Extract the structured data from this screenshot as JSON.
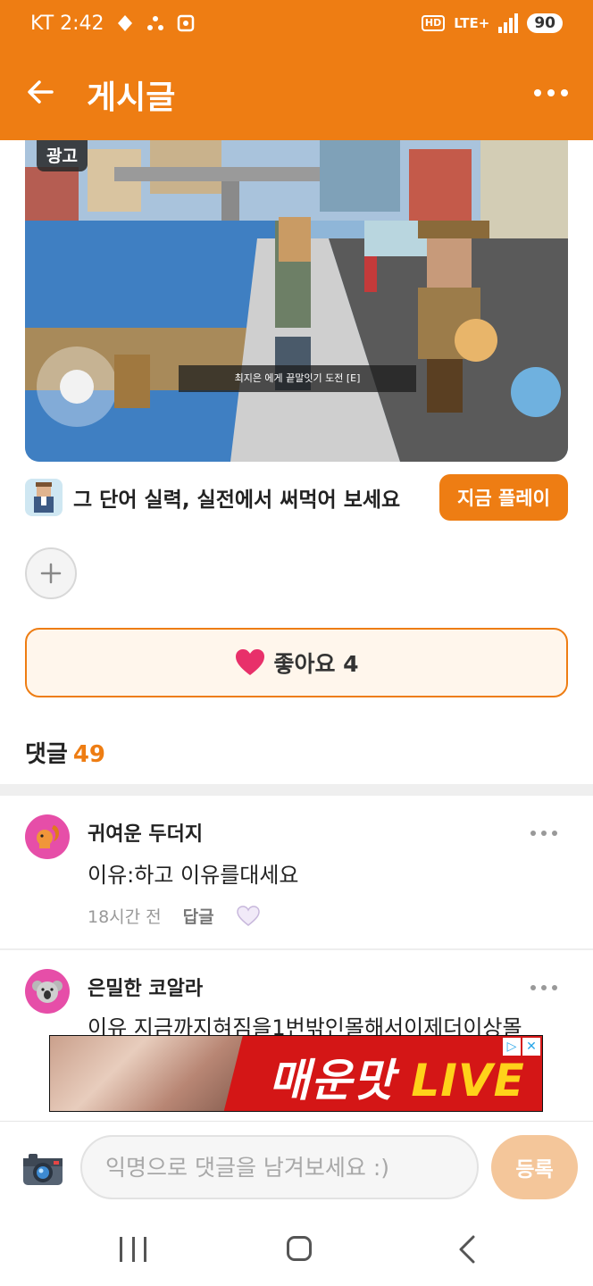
{
  "status_bar": {
    "carrier_time": "KT 2:42",
    "network_hd": "HD",
    "network": "LTE+",
    "battery": "90"
  },
  "header": {
    "title": "게시글",
    "back_icon": "arrow-left-icon",
    "more_icon": "more-horizontal-icon"
  },
  "ad": {
    "badge": "광고",
    "game_caption": "최지은 에게 끝말잇기 도전 [E]",
    "tagline": "그 단어 실력, 실전에서 써먹어 보세요",
    "cta": "지금 플레이"
  },
  "like": {
    "icon": "heart-icon",
    "label": "좋아요 4"
  },
  "comments": {
    "label": "댓글",
    "count": "49",
    "items": [
      {
        "name": "귀여운 두더지",
        "avatar_icon": "squirrel-icon",
        "text": "이유:하고 이유를대세요",
        "time": "18시간 전",
        "reply_label": "답글",
        "like_icon": "heart-outline-icon"
      },
      {
        "name": "은밀한 코알라",
        "avatar_icon": "koala-icon",
        "text": "이유 지금까지혀짐을1번밖인몰해서이제더이상몰"
      }
    ]
  },
  "banner": {
    "text": "매운맛",
    "text_live": "LIVE"
  },
  "composer": {
    "placeholder": "익명으로 댓글을 남겨보세요 :)",
    "submit_label": "등록"
  },
  "colors": {
    "accent": "#ee7d13",
    "like_bg": "#fff6ec",
    "avatar_bg": "#e64ea8"
  }
}
